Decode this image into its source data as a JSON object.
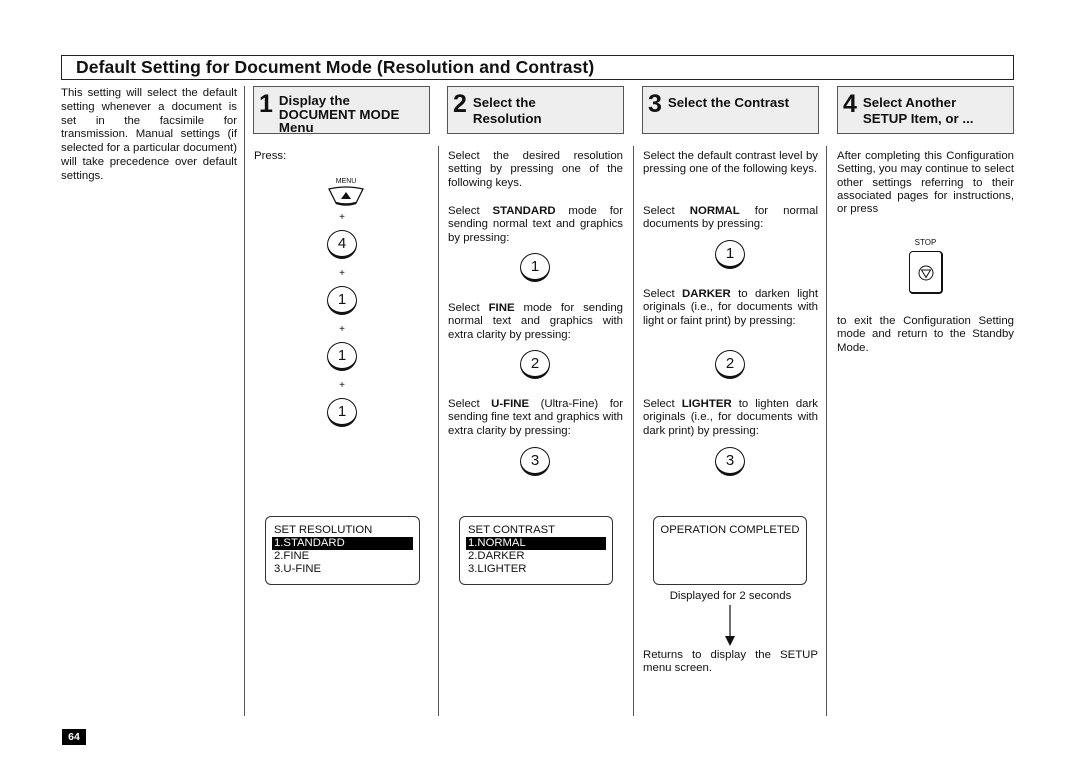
{
  "page": {
    "title": "Default Setting for Document Mode (Resolution and Contrast)",
    "intro": "This setting will select the default setting whenever a document is set in the facsimile for transmission. Manual settings (if selected for a particular document) will take precedence over default settings.",
    "page_number": "64"
  },
  "steps": [
    {
      "number": "1",
      "title_lines": [
        "Display the",
        "DOCUMENT MODE",
        "Menu"
      ],
      "press_label": "Press:",
      "menu_key_label": "MENU",
      "key_sequence": [
        "4",
        "1",
        "1",
        "1"
      ],
      "plus": "+",
      "lcd": {
        "heading": "SET RESOLUTION",
        "options": [
          "1.STANDARD",
          "2.FINE",
          "3.U-FINE"
        ],
        "selected_index": 0
      }
    },
    {
      "number": "2",
      "title_lines": [
        "Select the",
        "Resolution"
      ],
      "intro": "Select the desired resolution setting by pressing one of the following keys.",
      "options": [
        {
          "pre": "Select ",
          "bold": "STANDARD",
          "post": " mode for sending normal text and graphics by pressing:",
          "key": "1"
        },
        {
          "pre": "Select ",
          "bold": "FINE",
          "post": " mode for sending normal text and graphics with extra clarity by pressing:",
          "key": "2"
        },
        {
          "pre": "Select ",
          "bold": "U-FINE",
          "post": " (Ultra-Fine) for sending fine text and graphics with extra clarity by pressing:",
          "key": "3"
        }
      ],
      "lcd": {
        "heading": "SET CONTRAST",
        "options": [
          "1.NORMAL",
          "2.DARKER",
          "3.LIGHTER"
        ],
        "selected_index": 0
      }
    },
    {
      "number": "3",
      "title_lines": [
        "Select the Contrast"
      ],
      "intro": "Select the default contrast level by pressing one of the following keys.",
      "options": [
        {
          "pre": "Select ",
          "bold": "NORMAL",
          "post": " for normal documents by pressing:",
          "key": "1"
        },
        {
          "pre": "Select ",
          "bold": "DARKER",
          "post": " to darken light originals (i.e., for documents with light or faint print) by pressing:",
          "key": "2"
        },
        {
          "pre": "Select ",
          "bold": "LIGHTER",
          "post": " to lighten dark originals (i.e., for documents with dark print) by pressing:",
          "key": "3"
        }
      ],
      "lcd": {
        "heading": "OPERATION COMPLETED"
      },
      "display_note": "Displayed for 2 seconds",
      "return_note": "Returns to display the SETUP menu screen."
    },
    {
      "number": "4",
      "title_lines": [
        "Select Another",
        "SETUP Item, or ..."
      ],
      "text_before": "After completing this Configuration Setting, you may continue to select other settings referring to their associated pages for instructions, or press",
      "stop_key_label": "STOP",
      "text_after": "to exit the Configuration Setting mode and return to the Standby Mode."
    }
  ]
}
